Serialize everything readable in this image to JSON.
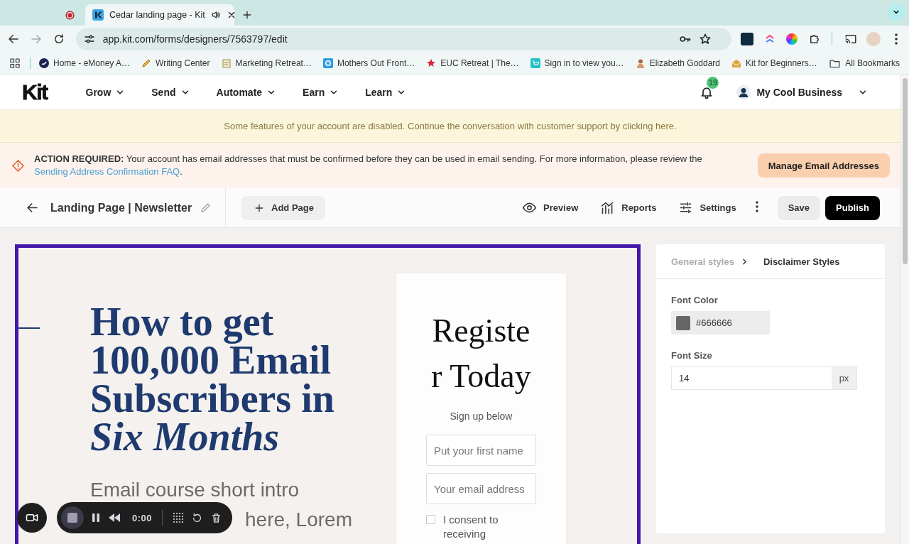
{
  "browser": {
    "tabs": [
      {
        "kind": "recording",
        "selected": false
      },
      {
        "kind": "page",
        "title": "Cedar landing page - Kit",
        "selected": true
      }
    ],
    "url": "app.kit.com/forms/designers/7563797/edit",
    "bookmarks": [
      {
        "kind": "emoney",
        "label": "Home - eMoney A…"
      },
      {
        "kind": "pencil",
        "label": "Writing Center"
      },
      {
        "kind": "notepad",
        "label": "Marketing Retreat…"
      },
      {
        "kind": "gear",
        "label": "Mothers Out Front…"
      },
      {
        "kind": "star",
        "label": "EUC Retreat | The…"
      },
      {
        "kind": "cart",
        "label": "Sign in to view you…"
      },
      {
        "kind": "person",
        "label": "Elizabeth Goddard"
      },
      {
        "kind": "envelope",
        "label": "Kit for Beginners…"
      }
    ],
    "all_bookmarks": "All Bookmarks"
  },
  "nav": {
    "logo": "Kit",
    "menus": [
      "Grow",
      "Send",
      "Automate",
      "Earn",
      "Learn"
    ],
    "notifications": "19",
    "account": "My Cool Business"
  },
  "notice": "Some features of your account are disabled. Continue the conversation with customer support by clicking here.",
  "action": {
    "text": "**ACTION REQUIRED:** Your account has email addresses that must be confirmed before they can be used in email sending. For more information, please review the ",
    "link": "Sending Address Confirmation FAQ",
    "after": ".",
    "button": "Manage Email Addresses"
  },
  "editor": {
    "title": "Landing Page | Newsletter",
    "add_page": "Add Page",
    "actions": [
      {
        "kind": "preview",
        "label": "Preview"
      },
      {
        "kind": "reports",
        "label": "Reports"
      },
      {
        "kind": "settings",
        "label": "Settings"
      }
    ],
    "save": "Save",
    "publish": "Publish"
  },
  "canvas": {
    "heading": "How to get 100,000 Email Subscribers in *Six Months*",
    "intro": "Email course short intro",
    "intro_visible_end": "here, Lorem",
    "form": {
      "title": "Register Today",
      "subtitle": "Sign up below",
      "fields": [
        {
          "placeholder": "Put your first name"
        },
        {
          "placeholder": "Your email address"
        }
      ],
      "consent": {
        "label": "I consent to receiving",
        "checked": false
      }
    }
  },
  "panel": {
    "breadcrumb": [
      {
        "label": "General styles",
        "selected": false
      },
      {
        "label": "Disclaimer Styles",
        "selected": true
      }
    ],
    "font_color": {
      "label": "Font Color",
      "value": "#666666"
    },
    "font_size": {
      "label": "Font Size",
      "value": "14",
      "unit": "px"
    }
  },
  "recorder": {
    "time": "0:00"
  }
}
